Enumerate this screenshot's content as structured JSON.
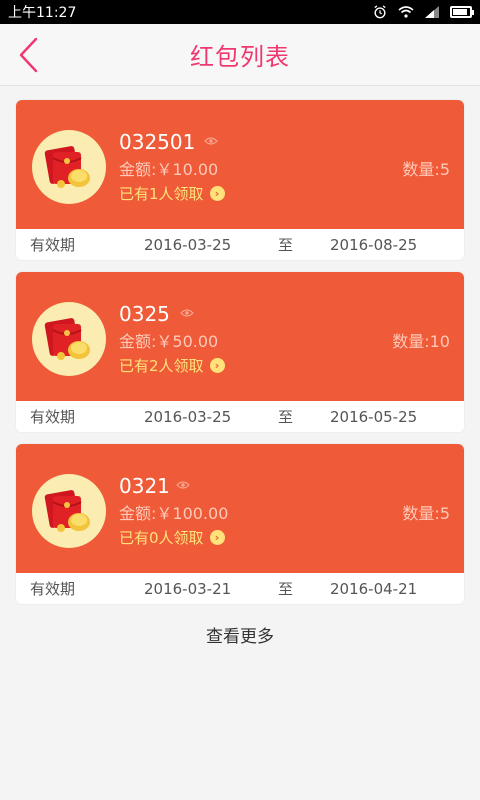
{
  "status_bar": {
    "time": "上午11:27"
  },
  "header": {
    "title": "红包列表"
  },
  "validity_label": "有效期",
  "separator": "至",
  "cards": [
    {
      "code": "032501",
      "amount": "金额:￥10.00",
      "claimed": "已有1人领取",
      "quantity": "数量:5",
      "start": "2016-03-25",
      "end": "2016-08-25"
    },
    {
      "code": "0325",
      "amount": "金额:￥50.00",
      "claimed": "已有2人领取",
      "quantity": "数量:10",
      "start": "2016-03-25",
      "end": "2016-05-25"
    },
    {
      "code": "0321",
      "amount": "金额:￥100.00",
      "claimed": "已有0人领取",
      "quantity": "数量:5",
      "start": "2016-03-21",
      "end": "2016-04-21"
    }
  ],
  "load_more": "查看更多",
  "colors": {
    "accent": "#f0376f",
    "card": "#ef5a38",
    "highlight": "#ffe37a"
  }
}
